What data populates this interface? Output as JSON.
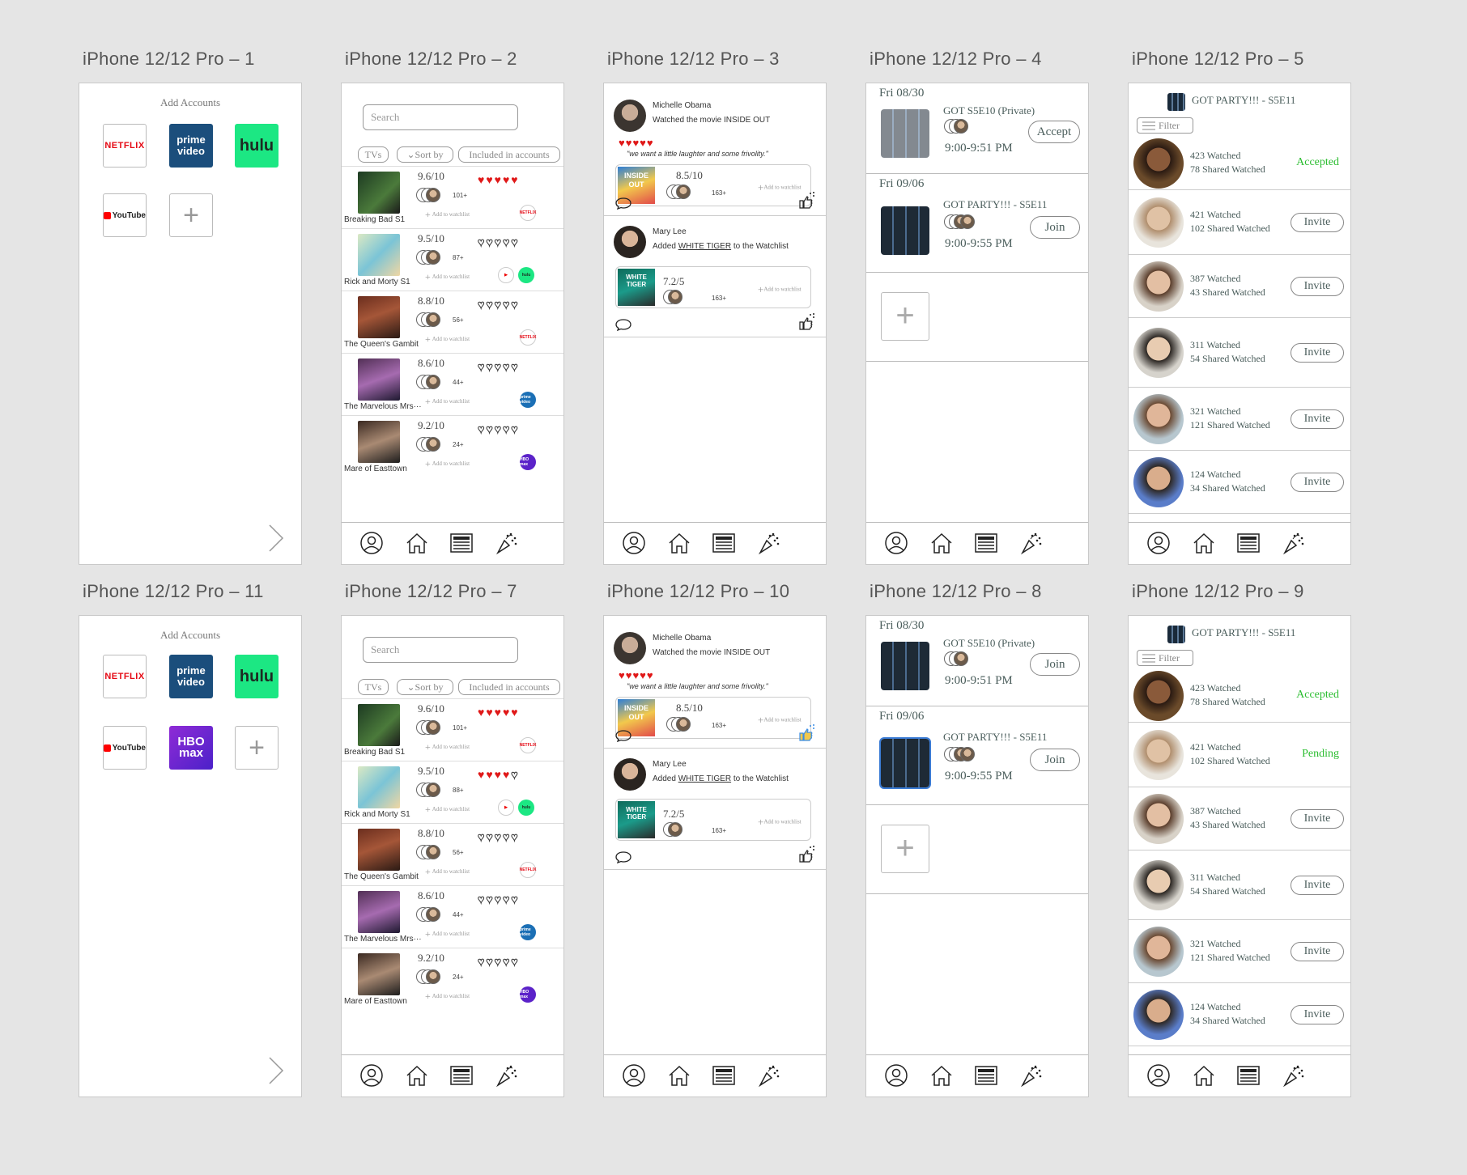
{
  "artboards": {
    "a1": "iPhone 12/12 Pro – 1",
    "a2": "iPhone 12/12 Pro – 2",
    "a3": "iPhone 12/12 Pro – 3",
    "a4": "iPhone 12/12 Pro – 4",
    "a5": "iPhone 12/12 Pro – 5",
    "a11": "iPhone 12/12 Pro – 11",
    "a7": "iPhone 12/12 Pro – 7",
    "a10": "iPhone 12/12 Pro – 10",
    "a8": "iPhone 12/12 Pro – 8",
    "a9": "iPhone 12/12 Pro – 9"
  },
  "accounts": {
    "title": "Add Accounts",
    "netflix": "NETFLIX",
    "prime_1": "prime",
    "prime_2": "video",
    "hulu": "hulu",
    "youtube": "YouTube",
    "hbo_1": "HBO",
    "hbo_2": "max",
    "add": "+"
  },
  "browse": {
    "search_placeholder": "Search",
    "filter_tvs": "TVs",
    "filter_sort": "Sort by",
    "filter_included": "Included in accounts",
    "add_watchlist": "Add to watchlist",
    "shows_a": [
      {
        "name": "Breaking Bad S1",
        "rating": "9.6/10",
        "count": "101+",
        "service": "NETFLIX"
      },
      {
        "name": "Rick and Morty S1",
        "rating": "9.5/10",
        "count": "87+",
        "service": "hulu"
      },
      {
        "name": "The Queen's Gambit",
        "rating": "8.8/10",
        "count": "56+",
        "service": "NETFLIX"
      },
      {
        "name": "The Marvelous Mrs···",
        "rating": "8.6/10",
        "count": "44+",
        "service": "prime video"
      },
      {
        "name": "Mare of Easttown",
        "rating": "9.2/10",
        "count": "24+",
        "service": "HBO max"
      }
    ],
    "shows_b": [
      {
        "name": "Breaking Bad S1",
        "rating": "9.6/10",
        "count": "101+",
        "service": "NETFLIX"
      },
      {
        "name": "Rick and Morty S1",
        "rating": "9.5/10",
        "count": "88+",
        "service": "hulu"
      },
      {
        "name": "The Queen's Gambit",
        "rating": "8.8/10",
        "count": "56+",
        "service": "NETFLIX"
      },
      {
        "name": "The Marvelous Mrs···",
        "rating": "8.6/10",
        "count": "44+",
        "service": "prime video"
      },
      {
        "name": "Mare of Easttown",
        "rating": "9.2/10",
        "count": "24+",
        "service": "HBO max"
      }
    ],
    "hearts_a": [
      5,
      0,
      0,
      0,
      0
    ],
    "hearts_b": [
      5,
      4,
      0,
      0,
      0
    ]
  },
  "feed": {
    "post1_user": "Michelle Obama",
    "post1_action": "Watched the movie INSIDE OUT",
    "post1_quote": "\"we want a little laughter and some frivolity.\"",
    "post1_rating": "8.5/10",
    "post1_count": "163+",
    "post1_hearts": 5,
    "post2_user": "Mary Lee",
    "post2_action_pre": "Added ",
    "post2_action_link": "WHITE TIGER",
    "post2_action_post": " to the Watchlist",
    "post2_rating": "7.2/5",
    "post2_count": "163+",
    "add_watchlist": "Add to watchlist",
    "poster1_text": "INSIDE OUT",
    "poster2_text": "WHITE TIGER"
  },
  "parties": {
    "p1_date": "Fri 08/30",
    "p1_title": "GOT S5E10 (Private)",
    "p1_time": "9:00-9:51 PM",
    "p1_btn_a": "Accept",
    "p1_btn_b": "Join",
    "p2_date": "Fri 09/06",
    "p2_title": "GOT PARTY!!! - S5E11",
    "p2_time": "9:00-9:55 PM",
    "p2_btn": "Join",
    "add": "+"
  },
  "invite": {
    "title": "GOT PARTY!!! - S5E11",
    "filter": "Filter",
    "people": [
      {
        "watched": "423 Watched",
        "shared": "78 Shared Watched",
        "status_a": "Accepted",
        "status_b": "Accepted"
      },
      {
        "watched": "421 Watched",
        "shared": "102 Shared Watched",
        "status_a": "Invite",
        "status_b": "Pending"
      },
      {
        "watched": "387 Watched",
        "shared": "43 Shared Watched",
        "status_a": "Invite",
        "status_b": "Invite"
      },
      {
        "watched": "311 Watched",
        "shared": "54 Shared Watched",
        "status_a": "Invite",
        "status_b": "Invite"
      },
      {
        "watched": "321 Watched",
        "shared": "121 Shared Watched",
        "status_a": "Invite",
        "status_b": "Invite"
      },
      {
        "watched": "124 Watched",
        "shared": "34 Shared Watched",
        "status_a": "Invite",
        "status_b": "Invite"
      }
    ]
  },
  "nav": {
    "icons": [
      "profile-icon",
      "home-icon",
      "feed-icon",
      "party-icon"
    ]
  },
  "colors": {
    "accepted_green": "#2bbd30",
    "pending_green": "#2bbd30",
    "heart_red": "#e01818",
    "text_teal": "#4a5d5b"
  }
}
